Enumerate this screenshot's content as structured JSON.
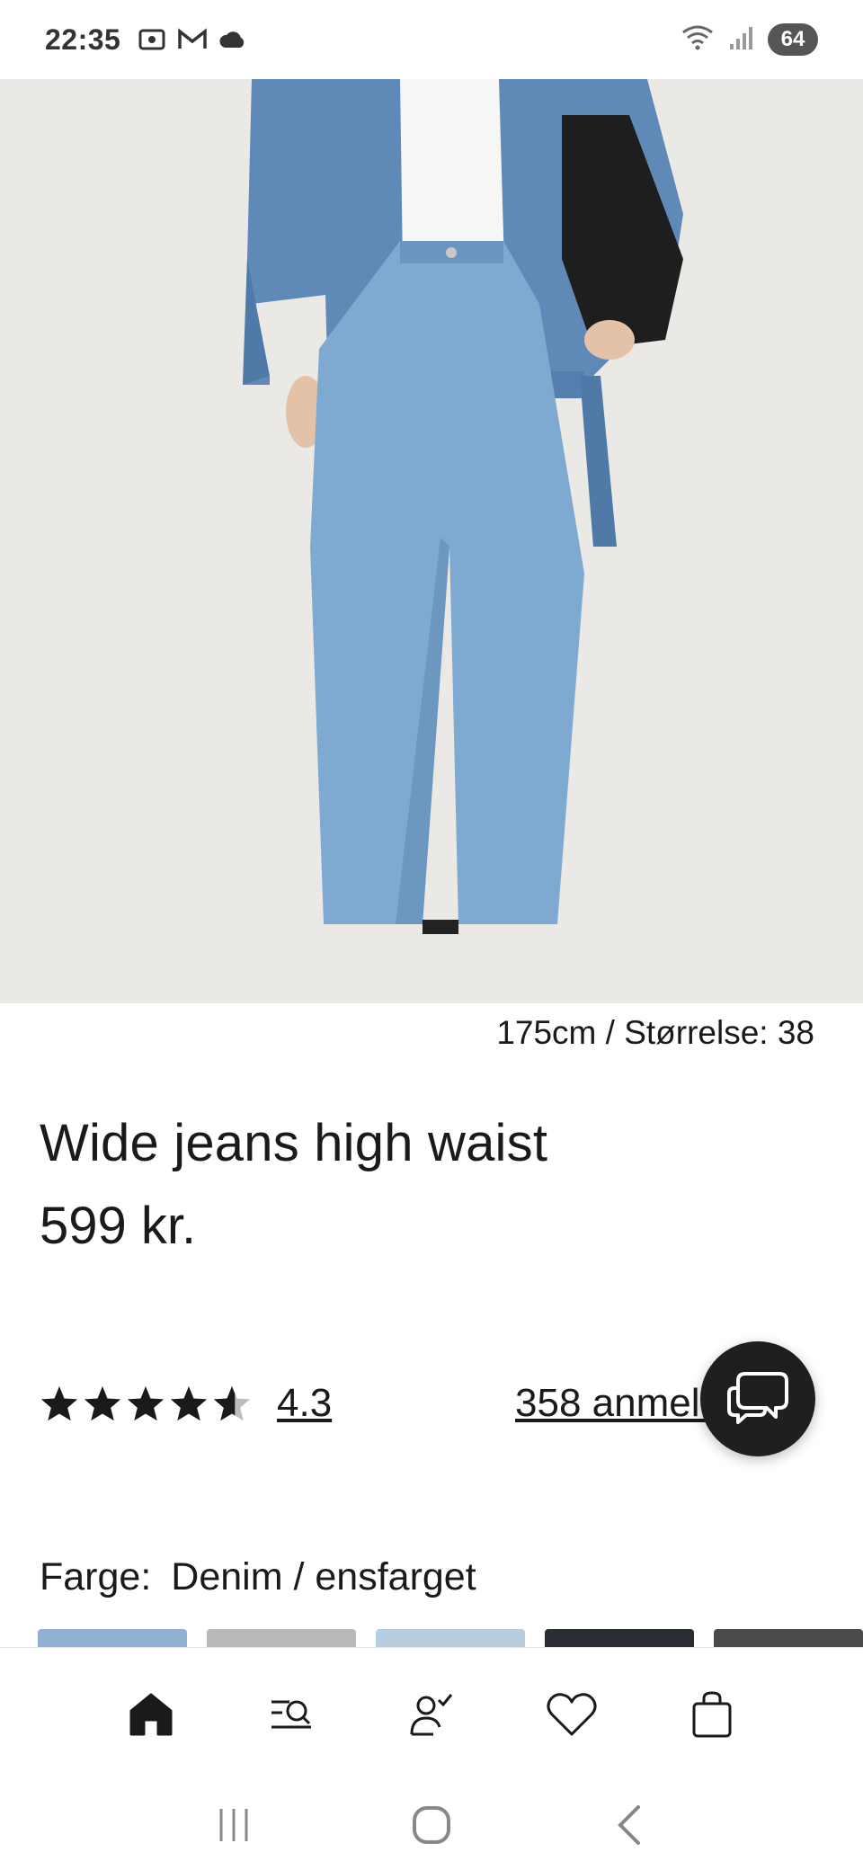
{
  "status_bar": {
    "time": "22:35",
    "battery": "64",
    "icons": [
      "screenshot-icon",
      "gmail-icon",
      "cloud-icon",
      "wifi-icon",
      "signal-icon"
    ]
  },
  "hero": {
    "image_description": "model-wearing-wide-jeans-and-denim-jacket",
    "pager_count": 7,
    "pager_active_index": 0
  },
  "product": {
    "model_info": "175cm /  Størrelse: 38",
    "title": "Wide jeans high waist",
    "price": "599 kr.",
    "rating": 4.3,
    "rating_text": "4.3",
    "reviews_text": "358 anmeldelser",
    "color_label": "Farge:",
    "color_value": "Denim / ensfarget"
  },
  "swatch_colors": [
    "#8fb0d0",
    "#b9b9b9",
    "#b7cde0",
    "#2a2d33",
    "#4a4a4a"
  ],
  "bottom_nav": {
    "items": [
      "home-icon",
      "search-icon",
      "account-icon",
      "wishlist-icon",
      "bag-icon"
    ]
  },
  "system_nav": {
    "items": [
      "recent-apps-icon",
      "home-button-icon",
      "back-icon"
    ]
  },
  "colors": {
    "text": "#1a1a1a",
    "fab": "#1f1f1f",
    "hero_bg": "#ebe9e6"
  }
}
